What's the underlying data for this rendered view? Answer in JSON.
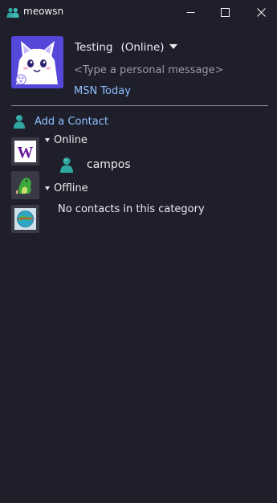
{
  "window": {
    "title": "meowsn",
    "app_icon": "msn-buddies-icon",
    "controls": [
      "minimize-icon",
      "maximize-icon",
      "close-icon"
    ]
  },
  "profile": {
    "display_name": "Testing",
    "status": "(Online)",
    "personal_message_placeholder": "<Type a personal message>",
    "link": "MSN Today",
    "avatar_icon": "cat-avatar"
  },
  "actions": {
    "add_contact": "Add a Contact"
  },
  "groups": [
    {
      "name": "Online",
      "contacts": [
        "campos"
      ]
    },
    {
      "name": "Offline",
      "empty_text": "No contacts in this category"
    }
  ],
  "sidebar_tiles": [
    "winamp-w-icon",
    "green-creature-icon",
    "globe-icon"
  ],
  "colors": {
    "background": "#1f1e2b",
    "link": "#8ec0ff",
    "buddy": "#2fa6a0",
    "divider": "#8d8d9a"
  }
}
